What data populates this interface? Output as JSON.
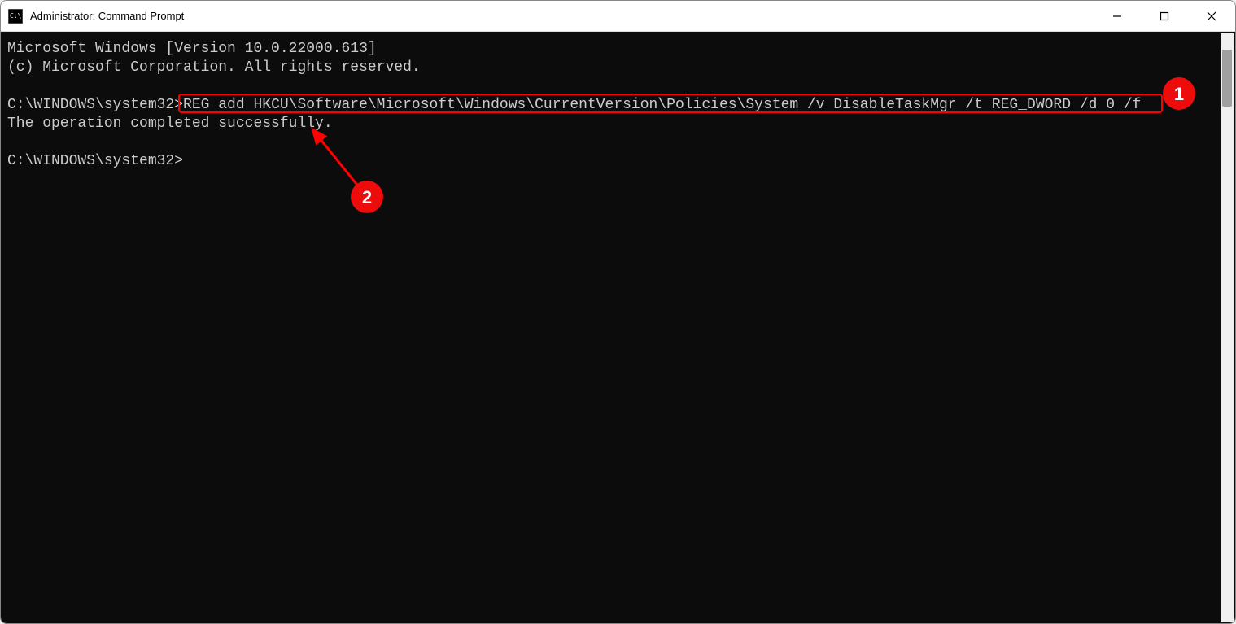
{
  "titlebar": {
    "title": "Administrator: Command Prompt"
  },
  "terminal": {
    "line1": "Microsoft Windows [Version 10.0.22000.613]",
    "line2": "(c) Microsoft Corporation. All rights reserved.",
    "line3_prompt": "C:\\WINDOWS\\system32>",
    "line3_command": "REG add HKCU\\Software\\Microsoft\\Windows\\CurrentVersion\\Policies\\System /v DisableTaskMgr /t REG_DWORD /d 0 /f",
    "line4": "The operation completed successfully.",
    "line5": "C:\\WINDOWS\\system32>"
  },
  "annotations": {
    "badge1": "1",
    "badge2": "2"
  }
}
